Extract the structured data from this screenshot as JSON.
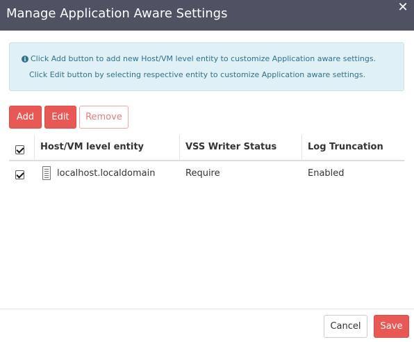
{
  "dialog": {
    "title": "Manage Application Aware Settings",
    "close_glyph": "✕",
    "close_icon": "close-icon"
  },
  "info": {
    "icon": "info-icon",
    "icon_glyph": "i",
    "line1": "Click Add button to add new Host/VM level entity to customize Application aware settings.",
    "line2": "Click Edit button by selecting respective entity to customize Application aware settings."
  },
  "toolbar": {
    "add_label": "Add",
    "edit_label": "Edit",
    "remove_label": "Remove"
  },
  "table": {
    "select_all_checked": true,
    "columns": [
      "Host/VM level entity",
      "VSS Writer Status",
      "Log Truncation"
    ],
    "rows": [
      {
        "checked": true,
        "icon": "server-icon",
        "entity": "localhost.localdomain",
        "vss_writer_status": "Require",
        "log_truncation": "Enabled"
      }
    ]
  },
  "footer": {
    "cancel_label": "Cancel",
    "save_label": "Save"
  },
  "colors": {
    "titlebar_bg": "#4e5263",
    "primary_button": "#e85855",
    "info_bg": "#dff0f6",
    "info_text": "#31708f"
  }
}
